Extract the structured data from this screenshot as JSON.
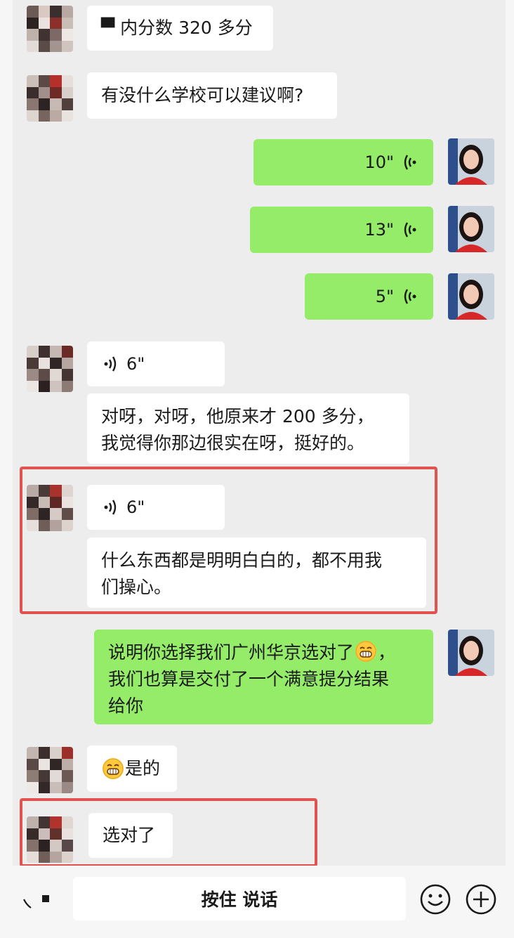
{
  "messages": {
    "m1": {
      "text": "▀ 内分数 320 多分"
    },
    "m2": {
      "text": "有没什么学校可以建议啊?"
    },
    "v1": {
      "duration": "10\""
    },
    "v2": {
      "duration": "13\""
    },
    "v3": {
      "duration": "5\""
    },
    "v4": {
      "duration": "6\""
    },
    "m3": {
      "text": "对呀，对呀，他原来才 200 多分，\n我觉得你那边很实在呀，挺好的。"
    },
    "v5": {
      "duration": "6\""
    },
    "m4": {
      "text": "什么东西都是明明白白的，都不用我\n们操心。"
    },
    "m5": {
      "line1": "说明你选择我们广州华京选对了",
      "line1_end": "，",
      "rest": "我们也算是交付了一个满意提分结果\n给你"
    },
    "m6": {
      "text": "是的"
    },
    "m7": {
      "text": "选对了"
    }
  },
  "input_bar": {
    "hold_label": "按住 说话"
  },
  "icons": {
    "voice_toggle": "voice-toggle-icon",
    "emoji_button": "smiley-icon",
    "plus_button": "plus-icon",
    "grin_emoji": "grinning-emoji-icon"
  },
  "colors": {
    "chat_bg": "#ededed",
    "bubble_me": "#95ec69",
    "bubble_them": "#ffffff",
    "highlight_frame": "#e0534f"
  }
}
